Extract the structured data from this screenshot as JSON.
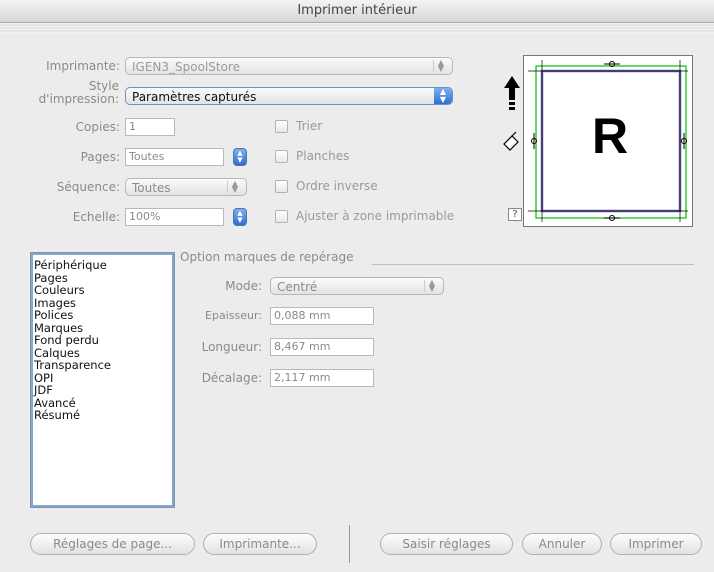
{
  "window": {
    "title": "Imprimer intérieur"
  },
  "form": {
    "printer_label": "Imprimante:",
    "printer_value": "IGEN3_SpoolStore",
    "style_label_line1": "Style",
    "style_label_line2": "d'impression:",
    "style_value": "Paramètres capturés",
    "copies_label": "Copies:",
    "copies_value": "1",
    "pages_label": "Pages:",
    "pages_value": "Toutes",
    "sequence_label": "Séquence:",
    "sequence_value": "Toutes",
    "scale_label": "Echelle:",
    "scale_value": "100%"
  },
  "checkboxes": {
    "collate": "Trier",
    "spreads": "Planches",
    "reverse": "Ordre inverse",
    "fit": "Ajuster à zone imprimable"
  },
  "preview": {
    "letter": "R",
    "help": "?"
  },
  "categories": [
    "Périphérique",
    "Pages",
    "Couleurs",
    "Images",
    "Polices",
    "Marques",
    "Fond perdu",
    "Calques",
    "Transparence",
    "OPI",
    "JDF",
    "Avancé",
    "Résumé"
  ],
  "marks": {
    "group_title": "Option marques de repérage",
    "mode_label": "Mode:",
    "mode_value": "Centré",
    "thickness_label": "Epaisseur:",
    "thickness_value": "0,088 mm",
    "length_label": "Longueur:",
    "length_value": "8,467 mm",
    "offset_label": "Décalage:",
    "offset_value": "2,117 mm"
  },
  "buttons": {
    "page_setup": "Réglages de page...",
    "printer": "Imprimante...",
    "capture": "Saisir réglages",
    "cancel": "Annuler",
    "print": "Imprimer"
  }
}
